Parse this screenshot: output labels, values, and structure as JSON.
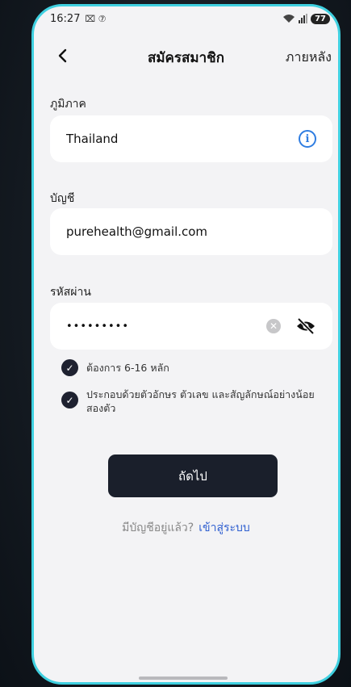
{
  "status_bar": {
    "time": "16:27",
    "indicators": "⌧ ⑦",
    "battery": "77"
  },
  "nav": {
    "title": "สมัครสมาชิก",
    "later_label": "ภายหลัง"
  },
  "form": {
    "region_label": "ภูมิภาค",
    "region_value": "Thailand",
    "account_label": "บัญชี",
    "account_value": "purehealth@gmail.com",
    "password_label": "รหัสผ่าน",
    "password_value": "•••••••••"
  },
  "rules": [
    {
      "text": "ต้องการ 6-16 หลัก"
    },
    {
      "text": "ประกอบด้วยตัวอักษร ตัวเลข และสัญลักษณ์อย่างน้อยสองตัว"
    }
  ],
  "actions": {
    "next_label": "ถัดไป",
    "have_account_text": "มีบัญชีอยู่แล้ว?",
    "login_label": "เข้าสู่ระบบ"
  },
  "icons": {
    "back": "chevron-left-icon",
    "info": "info-icon",
    "clear": "clear-icon",
    "hide_password": "eye-off-icon",
    "check": "check-circle-icon"
  },
  "colors": {
    "frame": "#3fd0e0",
    "button": "#1a1f2b",
    "link": "#2f5fd0",
    "info": "#2f7de1"
  }
}
